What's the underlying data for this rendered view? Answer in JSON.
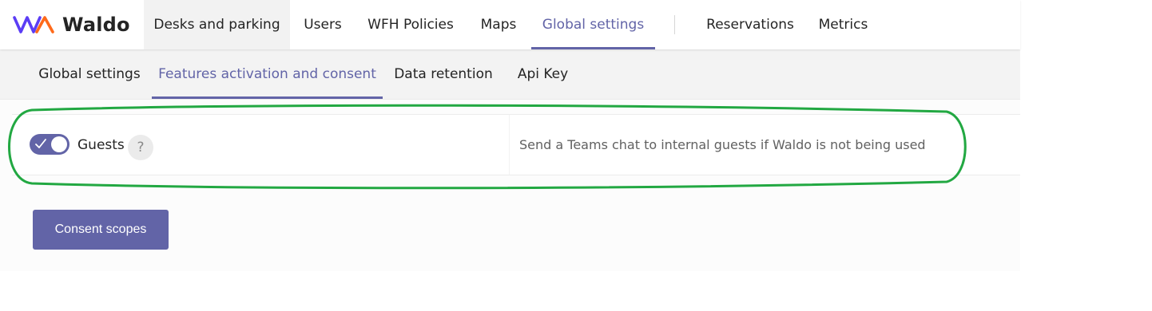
{
  "brand": {
    "name": "Waldo",
    "logo_icon": "waldo-wa-logo-icon",
    "colors": {
      "logo_purple": "#5b3df5",
      "logo_orange": "#ff6a1a"
    }
  },
  "topnav": {
    "items": [
      {
        "label": "Desks and parking"
      },
      {
        "label": "Users"
      },
      {
        "label": "WFH Policies"
      },
      {
        "label": "Maps"
      },
      {
        "label": "Global settings"
      },
      {
        "label": "Reservations"
      },
      {
        "label": "Metrics"
      }
    ],
    "active": "Global settings",
    "hovered": "Desks and parking"
  },
  "subnav": {
    "items": [
      {
        "label": "Global settings"
      },
      {
        "label": "Features activation and consent"
      },
      {
        "label": "Data retention"
      },
      {
        "label": "Api Key"
      }
    ],
    "active": "Features activation and consent"
  },
  "feature": {
    "label": "Guests",
    "enabled": true,
    "help_icon": "question-mark-icon",
    "help_glyph": "?",
    "description": "Send a Teams chat to internal guests if Waldo is not being used"
  },
  "consent_button": {
    "label": "Consent scopes"
  },
  "colors": {
    "accent": "#6264a7",
    "highlight": "#22a842",
    "subnav_bg": "#f3f3f3",
    "hover_bg": "#f2f2f2"
  }
}
